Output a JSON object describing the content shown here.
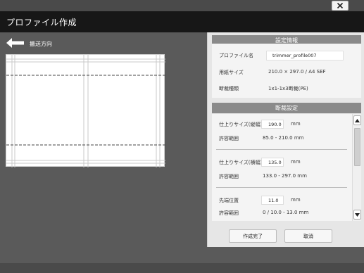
{
  "window": {
    "title": "プロファイル作成",
    "close_icon": "close-icon"
  },
  "feed": {
    "arrow_icon": "left-arrow-icon",
    "label": "搬送方向"
  },
  "settings_info": {
    "header": "設定情報",
    "profile_name_label": "プロファイル名",
    "profile_name_value": "trimmer_profile007",
    "paper_size_label": "用紙サイズ",
    "paper_size_value": "210.0 × 297.0 / A4 SEF",
    "cut_type_label": "断裁種類",
    "cut_type_value": "1x1-1x3断裁(PE)"
  },
  "cut_settings": {
    "header": "断裁設定",
    "items": [
      {
        "label": "仕上りサイズ(縦幅)",
        "value": "190.0",
        "unit": "mm",
        "range_label": "許容範囲",
        "range_value": "85.0 - 210.0 mm"
      },
      {
        "label": "仕上りサイズ(横幅)",
        "value": "135.0",
        "unit": "mm",
        "range_label": "許容範囲",
        "range_value": "133.0 - 297.0 mm"
      },
      {
        "label": "先端位置",
        "value": "11.0",
        "unit": "mm",
        "range_label": "許容範囲",
        "range_value": "0 / 10.0 - 13.0 mm"
      }
    ]
  },
  "buttons": {
    "complete": "作成完了",
    "cancel": "取消"
  },
  "colors": {
    "background": "#5a5a5a",
    "titlebar": "#171717",
    "panel": "#e6e6e6",
    "section_header": "#8a8a8a"
  }
}
